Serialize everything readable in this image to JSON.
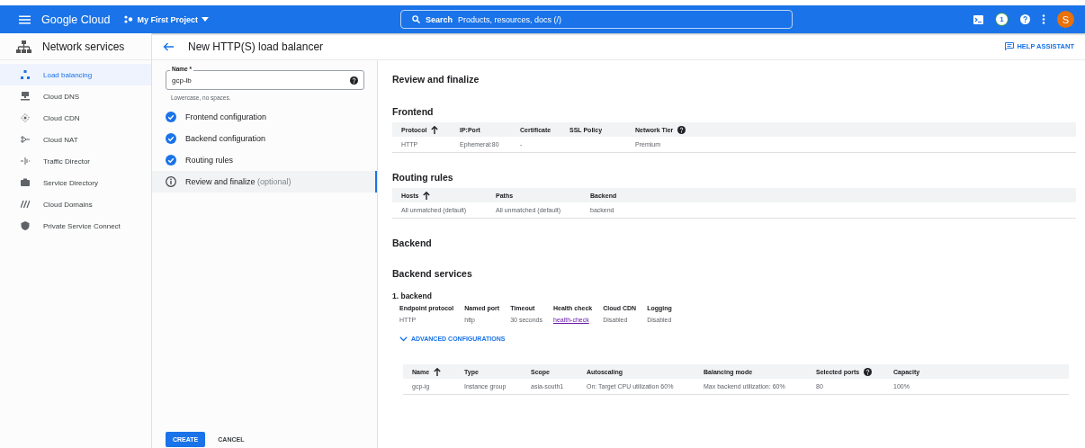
{
  "topbar": {
    "product": "Google Cloud",
    "project": "My First Project",
    "search_label": "Search",
    "search_hint": "Products, resources, docs (/)",
    "notification_count": "1",
    "avatar_letter": "S"
  },
  "sidebar": {
    "title": "Network services",
    "items": [
      {
        "label": "Load balancing",
        "selected": true
      },
      {
        "label": "Cloud DNS",
        "selected": false
      },
      {
        "label": "Cloud CDN",
        "selected": false
      },
      {
        "label": "Cloud NAT",
        "selected": false
      },
      {
        "label": "Traffic Director",
        "selected": false
      },
      {
        "label": "Service Directory",
        "selected": false
      },
      {
        "label": "Cloud Domains",
        "selected": false
      },
      {
        "label": "Private Service Connect",
        "selected": false
      }
    ]
  },
  "header": {
    "title": "New HTTP(S) load balancer",
    "help": "HELP ASSISTANT"
  },
  "name_field": {
    "label": "Name",
    "required": "*",
    "value": "gcp-lb",
    "hint": "Lowercase, no spaces."
  },
  "steps": [
    {
      "label": "Frontend configuration",
      "complete": true,
      "selected": false
    },
    {
      "label": "Backend configuration",
      "complete": true,
      "selected": false
    },
    {
      "label": "Routing rules",
      "complete": true,
      "selected": false
    },
    {
      "label": "Review and finalize",
      "note": "(optional)",
      "complete": false,
      "selected": true
    }
  ],
  "review": {
    "title": "Review and finalize",
    "frontend": {
      "title": "Frontend",
      "columns": [
        {
          "label": "Protocol",
          "sorted": true,
          "help": false
        },
        {
          "label": "IP:Port",
          "sorted": false,
          "help": false
        },
        {
          "label": "Certificate",
          "sorted": false,
          "help": false
        },
        {
          "label": "SSL Policy",
          "sorted": false,
          "help": false
        },
        {
          "label": "Network Tier",
          "sorted": false,
          "help": true
        }
      ],
      "rows": [
        [
          "HTTP",
          "Ephemeral:80",
          "-",
          "",
          "Premium"
        ]
      ]
    },
    "routing": {
      "title": "Routing rules",
      "columns": [
        {
          "label": "Hosts",
          "sorted": true,
          "help": false
        },
        {
          "label": "Paths",
          "sorted": false,
          "help": false
        },
        {
          "label": "Backend",
          "sorted": false,
          "help": false
        }
      ],
      "rows": [
        [
          "All unmatched (default)",
          "All unmatched (default)",
          "backend"
        ]
      ]
    },
    "backend_title": "Backend",
    "services_title": "Backend services",
    "service": {
      "title": "1. backend",
      "fields": [
        {
          "label": "Endpoint protocol",
          "value": "HTTP",
          "kind": "text"
        },
        {
          "label": "Named port",
          "value": "http",
          "kind": "text"
        },
        {
          "label": "Timeout",
          "value": "30 seconds",
          "kind": "text"
        },
        {
          "label": "Health check",
          "value": "health-check",
          "kind": "link"
        },
        {
          "label": "Cloud CDN",
          "value": "Disabled",
          "kind": "text"
        },
        {
          "label": "Logging",
          "value": "Disabled",
          "kind": "text"
        }
      ],
      "advanced": "ADVANCED CONFIGURATIONS",
      "table": {
        "columns": [
          {
            "label": "Name",
            "sorted": true,
            "help": false
          },
          {
            "label": "Type",
            "sorted": false,
            "help": false
          },
          {
            "label": "Scope",
            "sorted": false,
            "help": false
          },
          {
            "label": "Autoscaling",
            "sorted": false,
            "help": false
          },
          {
            "label": "Balancing mode",
            "sorted": false,
            "help": false
          },
          {
            "label": "Selected ports",
            "sorted": false,
            "help": true
          },
          {
            "label": "Capacity",
            "sorted": false,
            "help": false
          }
        ],
        "rows": [
          [
            "gcp-ig",
            "Instance group",
            "asia-south1",
            "On: Target CPU utilization 60%",
            "Max backend utilization: 60%",
            "80",
            "100%"
          ]
        ]
      }
    }
  },
  "buttons": {
    "create": "CREATE",
    "cancel": "CANCEL"
  }
}
